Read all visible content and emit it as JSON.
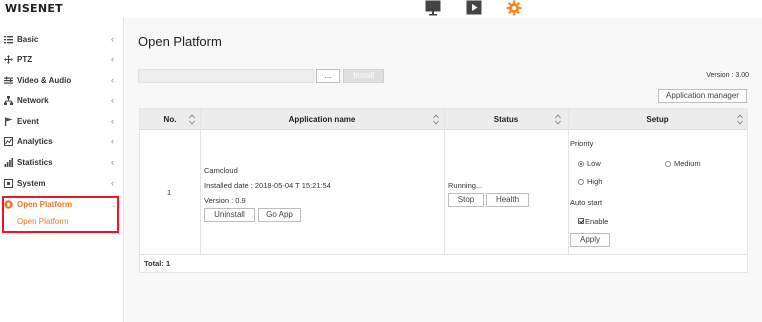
{
  "brand": {
    "logo_text": "WISENET"
  },
  "top_nav": [
    {
      "icon": "monitor-icon",
      "active": false
    },
    {
      "icon": "play-icon",
      "active": false
    },
    {
      "icon": "gear-icon",
      "active": true,
      "color": "#f08a24"
    }
  ],
  "sidebar": {
    "items": [
      {
        "label": "Basic",
        "icon": "list-icon"
      },
      {
        "label": "PTZ",
        "icon": "move-arrows-icon"
      },
      {
        "label": "Video & Audio",
        "icon": "video-audio-icon"
      },
      {
        "label": "Network",
        "icon": "network-icon"
      },
      {
        "label": "Event",
        "icon": "event-flag-icon"
      },
      {
        "label": "Analytics",
        "icon": "analytics-icon"
      },
      {
        "label": "Statistics",
        "icon": "statistics-bar-icon"
      },
      {
        "label": "System",
        "icon": "system-icon"
      },
      {
        "label": "Open Platform",
        "icon": "open-platform-icon",
        "active": true
      }
    ],
    "sub_items": [
      {
        "label": "Open Platform",
        "active": true
      }
    ],
    "chevron": "‹",
    "active_color": "#e8782a",
    "highlight_color": "#e8182a"
  },
  "main": {
    "title": "Open Platform",
    "browse_label": "...",
    "install_label": "Install",
    "version_text": "Version : 3.00",
    "app_manager_label": "Application manager",
    "table": {
      "headers": {
        "no": "No.",
        "name": "Application name",
        "status": "Status",
        "setup": "Setup"
      },
      "rows": [
        {
          "no": "1",
          "app_name": "Camcloud",
          "installed": "Installed date : 2018-05-04 T 15:21:54",
          "version": "Version : 0.9",
          "uninstall_label": "Uninstall",
          "goapp_label": "Go App",
          "status_text": "Running...",
          "stop_label": "Stop",
          "health_label": "Health",
          "priority_label": "Priority",
          "priority_options": [
            "Low",
            "Medium",
            "High"
          ],
          "priority_selected": "Low",
          "autostart_label": "Auto start",
          "enable_label": "Enable",
          "enable_checked": true,
          "apply_label": "Apply"
        }
      ],
      "total_text": "Total: 1"
    }
  }
}
